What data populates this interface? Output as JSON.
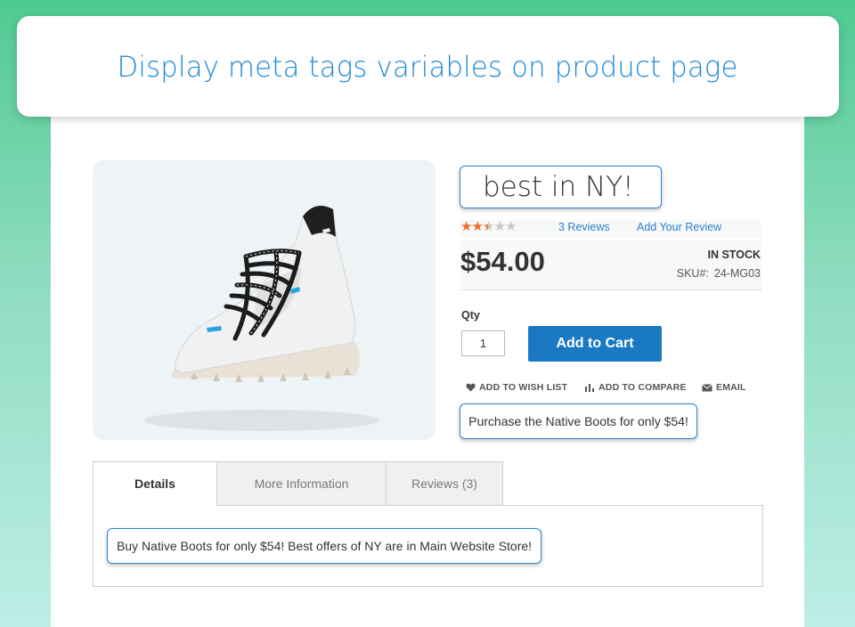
{
  "banner": {
    "title": "Display meta tags variables on product page"
  },
  "product": {
    "image_icon": "boot-image",
    "meta_title": "best in NY!",
    "rating": {
      "value": 2.5,
      "max": 5,
      "accent": "#f26c2b"
    },
    "reviews_link": "3 Reviews",
    "add_review_link": "Add Your Review",
    "price": "$54.00",
    "stock_status": "IN STOCK",
    "sku_label": "SKU#:",
    "sku_value": "24-MG03",
    "qty_label": "Qty",
    "qty_value": "1",
    "add_to_cart": "Add to Cart",
    "actions": {
      "wishlist": "ADD TO WISH LIST",
      "compare": "ADD TO COMPARE",
      "email": "EMAIL"
    },
    "meta_description": "Purchase the Native Boots for only $54!"
  },
  "tabs": [
    {
      "label": "Details",
      "active": true
    },
    {
      "label": "More Information",
      "active": false
    },
    {
      "label": "Reviews (3)",
      "active": false
    }
  ],
  "details": {
    "meta_keywords": "Buy Native Boots for only $54! Best offers of NY are in Main Website Store!"
  },
  "colors": {
    "accent_blue": "#1f88d6",
    "button_blue": "#1979c3",
    "link_blue": "#2a7fcf"
  }
}
